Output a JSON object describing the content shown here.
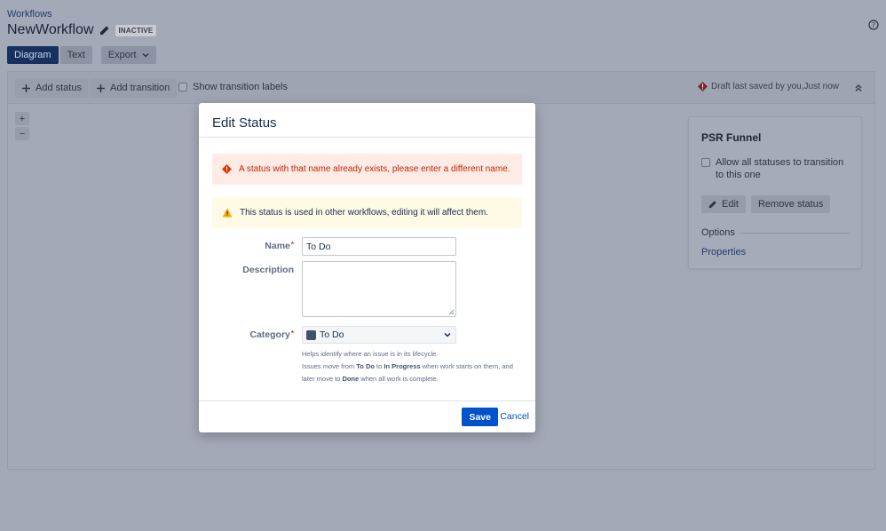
{
  "page": {
    "breadcrumb": "Workflows",
    "title": "NewWorkflow",
    "status_badge": "INACTIVE",
    "tabs": [
      "Diagram",
      "Text",
      "Export"
    ],
    "active_tab": "Diagram"
  },
  "toolbar": {
    "add_status": "Add status",
    "add_transition": "Add transition",
    "show_transition_labels": "Show transition labels",
    "draft_message": "Draft last saved by you,Just now"
  },
  "zoom": {
    "in": "+",
    "out": "−"
  },
  "side_panel": {
    "title": "PSR Funnel",
    "allow_all_label": "Allow all statuses to transition to this one",
    "edit_button": "Edit",
    "remove_button": "Remove status",
    "options_heading": "Options",
    "properties_link": "Properties"
  },
  "modal": {
    "title": "Edit Status",
    "error_message": "A status with that name already exists, please enter a different name.",
    "warning_message": "This status is used in other workflows, editing it will affect them.",
    "name_label": "Name",
    "name_value": "To Do",
    "description_label": "Description",
    "description_value": "",
    "category_label": "Category",
    "category_value": "To Do",
    "help_line1": "Helps identify where an issue is in its lifecycle.",
    "help_line2_a": "Issues move from ",
    "help_line2_b": "To Do",
    "help_line2_c": " to ",
    "help_line2_d": "In Progress",
    "help_line2_e": " when work starts on them, and",
    "help_line3_a": "later move to ",
    "help_line3_b": "Done",
    "help_line3_c": " when all work is complete.",
    "save_button": "Save",
    "cancel_button": "Cancel"
  },
  "colors": {
    "primary": "#0052cc",
    "error_bg": "#ffebe6",
    "error_text": "#bf2600",
    "warning_bg": "#fffae6",
    "warning_icon": "#ffab00",
    "category_swatch": "#42526e"
  }
}
